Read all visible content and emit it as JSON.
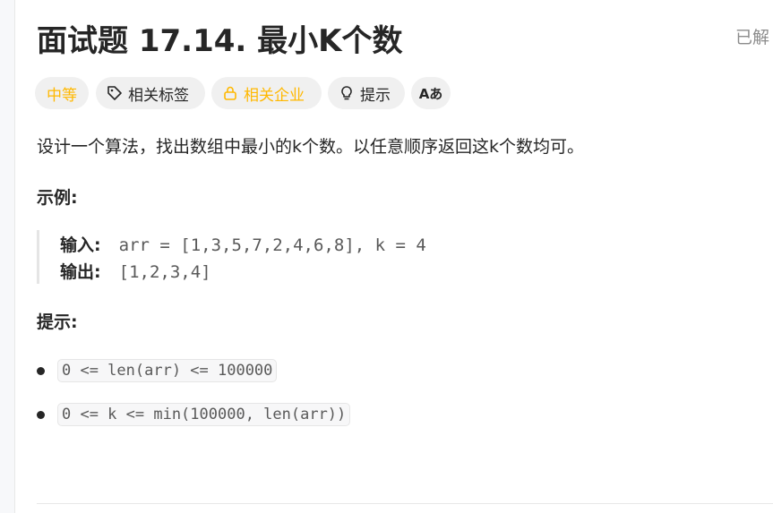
{
  "problem": {
    "title": "面试题 17.14. 最小K个数",
    "status": "已解",
    "tags": {
      "difficulty": "中等",
      "related_tags": "相关标签",
      "related_companies": "相关企业",
      "hint": "提示",
      "translate_icon_label": "Aあ"
    },
    "description": "设计一个算法，找出数组中最小的k个数。以任意顺序返回这k个数均可。",
    "example_heading": "示例:",
    "example": {
      "input_label": "输入:",
      "input_value": "arr = [1,3,5,7,2,4,6,8], k = 4",
      "output_label": "输出:",
      "output_value": "[1,2,3,4]"
    },
    "constraints_heading": "提示:",
    "constraints": [
      "0 <= len(arr) <= 100000",
      "0 <= k <= min(100000, len(arr))"
    ]
  },
  "colors": {
    "difficulty_medium": "#ffb800",
    "tag_bg": "#f0f0f0",
    "text": "#262626",
    "muted": "#8c8c8c"
  },
  "icons": [
    "tag-icon",
    "lock-icon",
    "lightbulb-icon",
    "translate-icon"
  ]
}
